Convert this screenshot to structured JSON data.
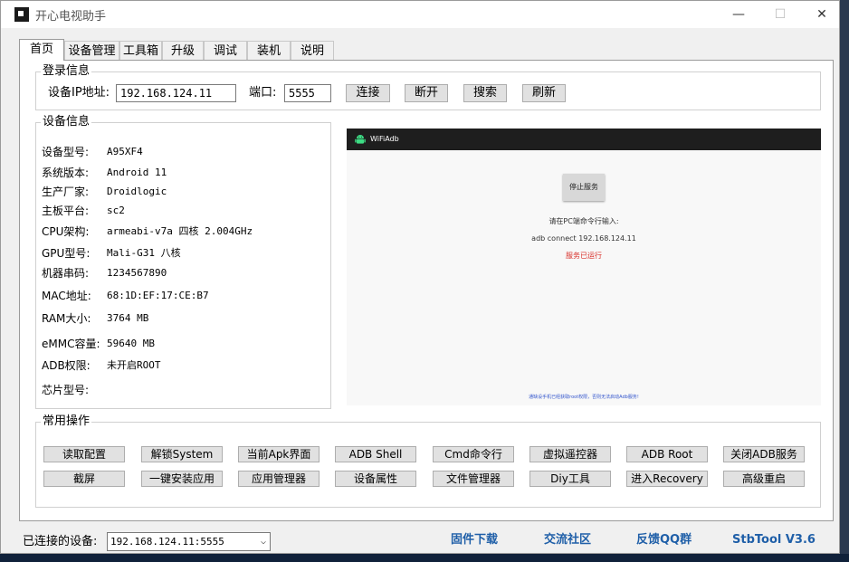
{
  "window": {
    "title": "开心电视助手",
    "minimize": "—",
    "maximize": "☐",
    "close": "✕"
  },
  "tabs": [
    "首页",
    "设备管理",
    "工具箱",
    "升级",
    "调试",
    "装机",
    "说明"
  ],
  "login": {
    "group_title": "登录信息",
    "ip_label": "设备IP地址:",
    "ip_value": "192.168.124.11",
    "port_label": "端口:",
    "port_value": "5555",
    "buttons": [
      "连接",
      "断开",
      "搜索",
      "刷新"
    ]
  },
  "device_info": {
    "group_title": "设备信息",
    "rows": [
      {
        "label": "设备型号:",
        "value": "A95XF4"
      },
      {
        "label": "系统版本:",
        "value": "Android 11"
      },
      {
        "label": "生产厂家:",
        "value": "Droidlogic"
      },
      {
        "label": "主板平台:",
        "value": "sc2"
      },
      {
        "label": "CPU架构:",
        "value": "armeabi-v7a 四核 2.004GHz"
      },
      {
        "label": "GPU型号:",
        "value": "Mali-G31 八核"
      },
      {
        "label": "机器串码:",
        "value": "1234567890"
      },
      {
        "label": "MAC地址:",
        "value": "68:1D:EF:17:CE:B7"
      },
      {
        "label": "RAM大小:",
        "value": "3764 MB"
      },
      {
        "label": "eMMC容量:",
        "value": "59640 MB"
      },
      {
        "label": "ADB权限:",
        "value": "未开启ROOT"
      },
      {
        "label": "芯片型号:",
        "value": ""
      }
    ]
  },
  "phone_preview": {
    "app_title": "WiFiAdb",
    "stop_button": "停止服务",
    "prompt": "请在PC端命令行输入:",
    "command": "adb connect 192.168.124.11",
    "status": "服务已运行",
    "footer_note": "通缺设手机已经获取root权限，否则无法启动Adb服务!"
  },
  "operations": {
    "group_title": "常用操作",
    "row1": [
      "读取配置",
      "解锁System",
      "当前Apk界面",
      "ADB Shell",
      "Cmd命令行",
      "虚拟遥控器",
      "ADB  Root",
      "关闭ADB服务"
    ],
    "row2": [
      "截屏",
      "一键安装应用",
      "应用管理器",
      "设备属性",
      "文件管理器",
      "Diy工具",
      "进入Recovery",
      "高级重启"
    ]
  },
  "footer": {
    "connected_label": "已连接的设备:",
    "connected_device": "192.168.124.11:5555",
    "links": [
      "固件下载",
      "交流社区",
      "反馈QQ群",
      "StbTool V3.6"
    ]
  },
  "colors": {
    "link": "#1f5fa8",
    "status_red": "#d9302a",
    "footer_note_blue": "#3355cc"
  }
}
